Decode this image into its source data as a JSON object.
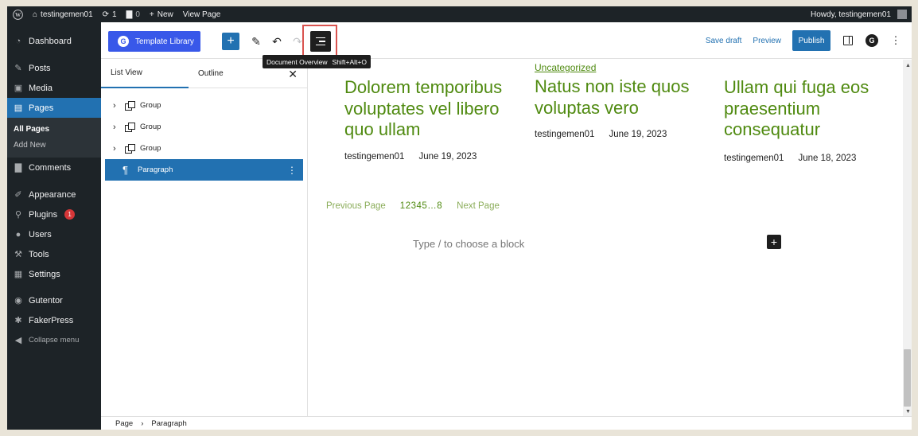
{
  "admin_bar": {
    "site_name": "testingemen01",
    "updates_count": "1",
    "comments_count": "0",
    "new_label": "New",
    "view_page_label": "View Page",
    "howdy": "Howdy, testingemen01"
  },
  "sidebar": {
    "items": [
      {
        "label": "Dashboard",
        "icon": "dashboard-icon"
      },
      {
        "label": "Posts",
        "icon": "pin-icon"
      },
      {
        "label": "Media",
        "icon": "media-icon"
      },
      {
        "label": "Pages",
        "icon": "pages-icon"
      },
      {
        "label": "Comments",
        "icon": "comment-icon"
      },
      {
        "label": "Appearance",
        "icon": "brush-icon"
      },
      {
        "label": "Plugins",
        "icon": "plugin-icon",
        "badge": "1"
      },
      {
        "label": "Users",
        "icon": "user-icon"
      },
      {
        "label": "Tools",
        "icon": "wrench-icon"
      },
      {
        "label": "Settings",
        "icon": "settings-icon"
      },
      {
        "label": "Gutentor",
        "icon": "gutentor-icon"
      },
      {
        "label": "FakerPress",
        "icon": "fakerpress-icon"
      },
      {
        "label": "Collapse menu",
        "icon": "collapse-icon"
      }
    ],
    "pages_submenu": [
      "All Pages",
      "Add New"
    ]
  },
  "header": {
    "template_library": "Template Library",
    "save_draft": "Save draft",
    "preview": "Preview",
    "publish": "Publish",
    "tooltip_label": "Document Overview",
    "tooltip_shortcut": "Shift+Alt+O"
  },
  "list_panel": {
    "tabs": [
      "List View",
      "Outline"
    ],
    "close": "✕",
    "rows": [
      {
        "label": "Group"
      },
      {
        "label": "Group"
      },
      {
        "label": "Group"
      },
      {
        "label": "Paragraph"
      }
    ]
  },
  "canvas": {
    "posts": [
      {
        "category": "",
        "title": "Dolorem temporibus voluptates vel libero quo ullam",
        "author": "testingemen01",
        "date": "June 19, 2023"
      },
      {
        "category": "Uncategorized",
        "title": "Natus non iste quos voluptas vero",
        "author": "testingemen01",
        "date": "June 19, 2023"
      },
      {
        "category": "",
        "title": "Ullam qui fuga eos praesentium consequatur",
        "author": "testingemen01",
        "date": "June 18, 2023"
      }
    ],
    "pagination": {
      "previous": "Previous Page",
      "numbers": "12345…8",
      "next": "Next Page"
    },
    "block_hint": "Type / to choose a block"
  },
  "breadcrumb": [
    "Page",
    "Paragraph"
  ],
  "colors": {
    "accent": "#2271b1",
    "admin_dark": "#1d2327",
    "post_title_green": "#4f8a10",
    "highlight_red": "#d9534f"
  }
}
